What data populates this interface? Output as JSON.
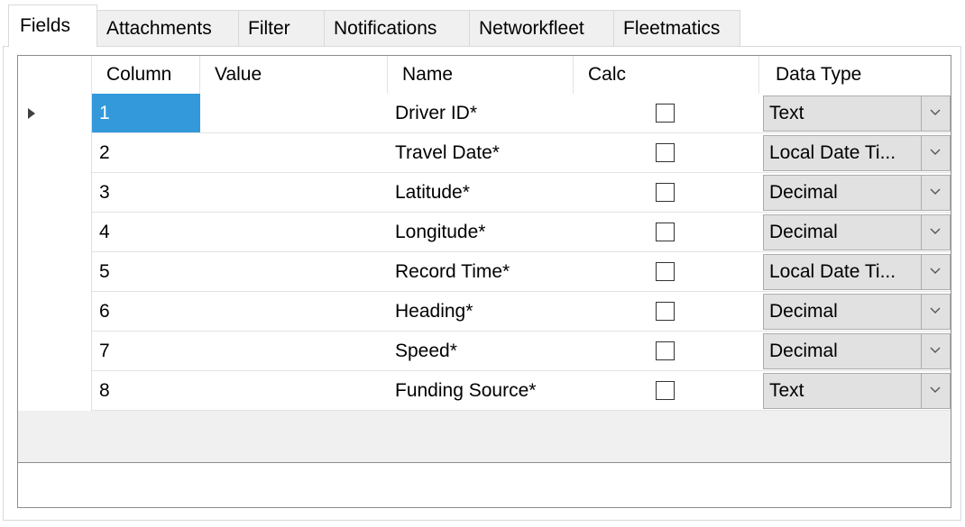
{
  "tabs": [
    {
      "label": "Fields",
      "active": true
    },
    {
      "label": "Attachments",
      "active": false
    },
    {
      "label": "Filter",
      "active": false
    },
    {
      "label": "Notifications",
      "active": false
    },
    {
      "label": "Networkfleet",
      "active": false
    },
    {
      "label": "Fleetmatics",
      "active": false
    }
  ],
  "grid": {
    "columns": {
      "column": "Column",
      "value": "Value",
      "name": "Name",
      "calc": "Calc",
      "data_type": "Data Type"
    },
    "rows": [
      {
        "column": "1",
        "value": "",
        "name": "Driver ID*",
        "calc": false,
        "data_type": "Text",
        "selected": true
      },
      {
        "column": "2",
        "value": "",
        "name": "Travel Date*",
        "calc": false,
        "data_type": "Local Date Ti...",
        "selected": false
      },
      {
        "column": "3",
        "value": "",
        "name": "Latitude*",
        "calc": false,
        "data_type": "Decimal",
        "selected": false
      },
      {
        "column": "4",
        "value": "",
        "name": "Longitude*",
        "calc": false,
        "data_type": "Decimal",
        "selected": false
      },
      {
        "column": "5",
        "value": "",
        "name": "Record Time*",
        "calc": false,
        "data_type": "Local Date Ti...",
        "selected": false
      },
      {
        "column": "6",
        "value": "",
        "name": "Heading*",
        "calc": false,
        "data_type": "Decimal",
        "selected": false
      },
      {
        "column": "7",
        "value": "",
        "name": "Speed*",
        "calc": false,
        "data_type": "Decimal",
        "selected": false
      },
      {
        "column": "8",
        "value": "",
        "name": "Funding Source*",
        "calc": false,
        "data_type": "Text",
        "selected": false
      }
    ]
  },
  "colors": {
    "selection": "#3399db",
    "combo_bg": "#e1e1e1",
    "grid_bg": "#f0f0f0",
    "border": "#8c8c8c"
  },
  "icons": {
    "current_row": "triangle-right-icon",
    "dropdown": "chevron-down-icon"
  }
}
